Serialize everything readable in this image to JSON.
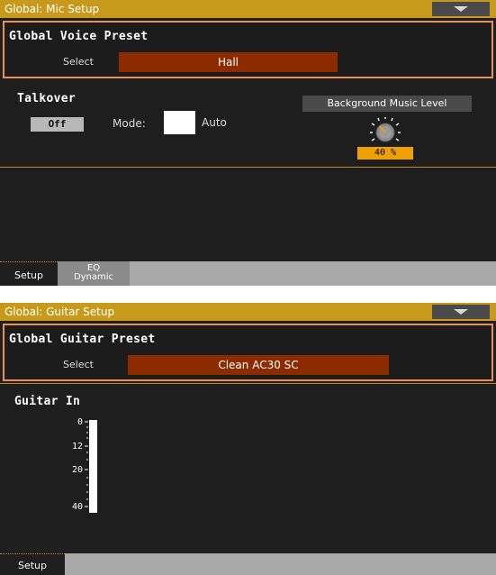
{
  "mic_setup": {
    "title": "Global: Mic Setup",
    "preset_section": {
      "title": "Global Voice Preset",
      "select_label": "Select",
      "select_value": "Hall"
    },
    "talkover": {
      "title": "Talkover",
      "toggle_value": "Off",
      "mode_label": "Mode:",
      "mode_value": "Auto"
    },
    "background_music": {
      "label": "Background Music Level",
      "value": "40 %"
    },
    "tabs": [
      {
        "label": "Setup",
        "active": true
      },
      {
        "label_line1": "EQ",
        "label_line2": "Dynamic",
        "active": false
      }
    ]
  },
  "guitar_setup": {
    "title": "Global: Guitar Setup",
    "preset_section": {
      "title": "Global Guitar Preset",
      "select_label": "Select",
      "select_value": "Clean AC30 SC"
    },
    "guitar_in": {
      "title": "Guitar In",
      "meter_labels": [
        "0",
        "12",
        "20",
        "40"
      ]
    },
    "tabs": [
      {
        "label": "Setup",
        "active": true
      }
    ]
  },
  "colors": {
    "title_bar": "#c89a1c",
    "panel_bg": "#1e1e1e",
    "preset_border": "#ee8c5c",
    "select_field": "#8c2a00",
    "level_badge": "#f0a000"
  }
}
